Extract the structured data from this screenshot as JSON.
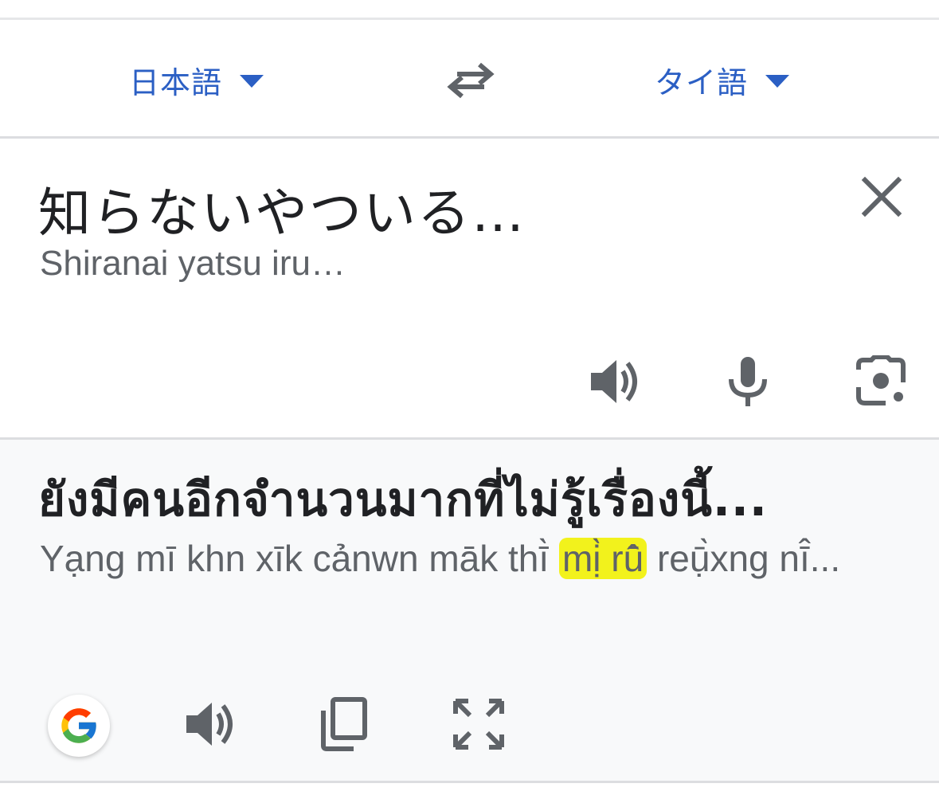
{
  "languages": {
    "source": "日本語",
    "target": "タイ語"
  },
  "source": {
    "text": "知らないやついる…",
    "romanization": "Shiranai yatsu iru…"
  },
  "translation": {
    "text": "ยังมีคนอีกจำนวนมากที่ไม่รู้เรื่องนี้...",
    "romanization_before": "Yạng mī khn xīk cảnwn māk thī̀ ",
    "romanization_highlight": "mị̀ rū̂",
    "romanization_after": " reụ̄̀xng nī̂...",
    "highlight_color": "#f2f21c"
  },
  "colors": {
    "accent": "#2b5fc4",
    "icon": "#5f6368",
    "result_bg": "#f8f9fa"
  },
  "icons": {
    "swap": "swap-arrows-icon",
    "clear": "close-icon",
    "source_speak": "speaker-icon",
    "mic": "microphone-icon",
    "camera": "camera-lens-icon",
    "google": "google-g-icon",
    "result_speak": "speaker-icon",
    "copy": "copy-icon",
    "fullscreen": "fullscreen-icon"
  }
}
